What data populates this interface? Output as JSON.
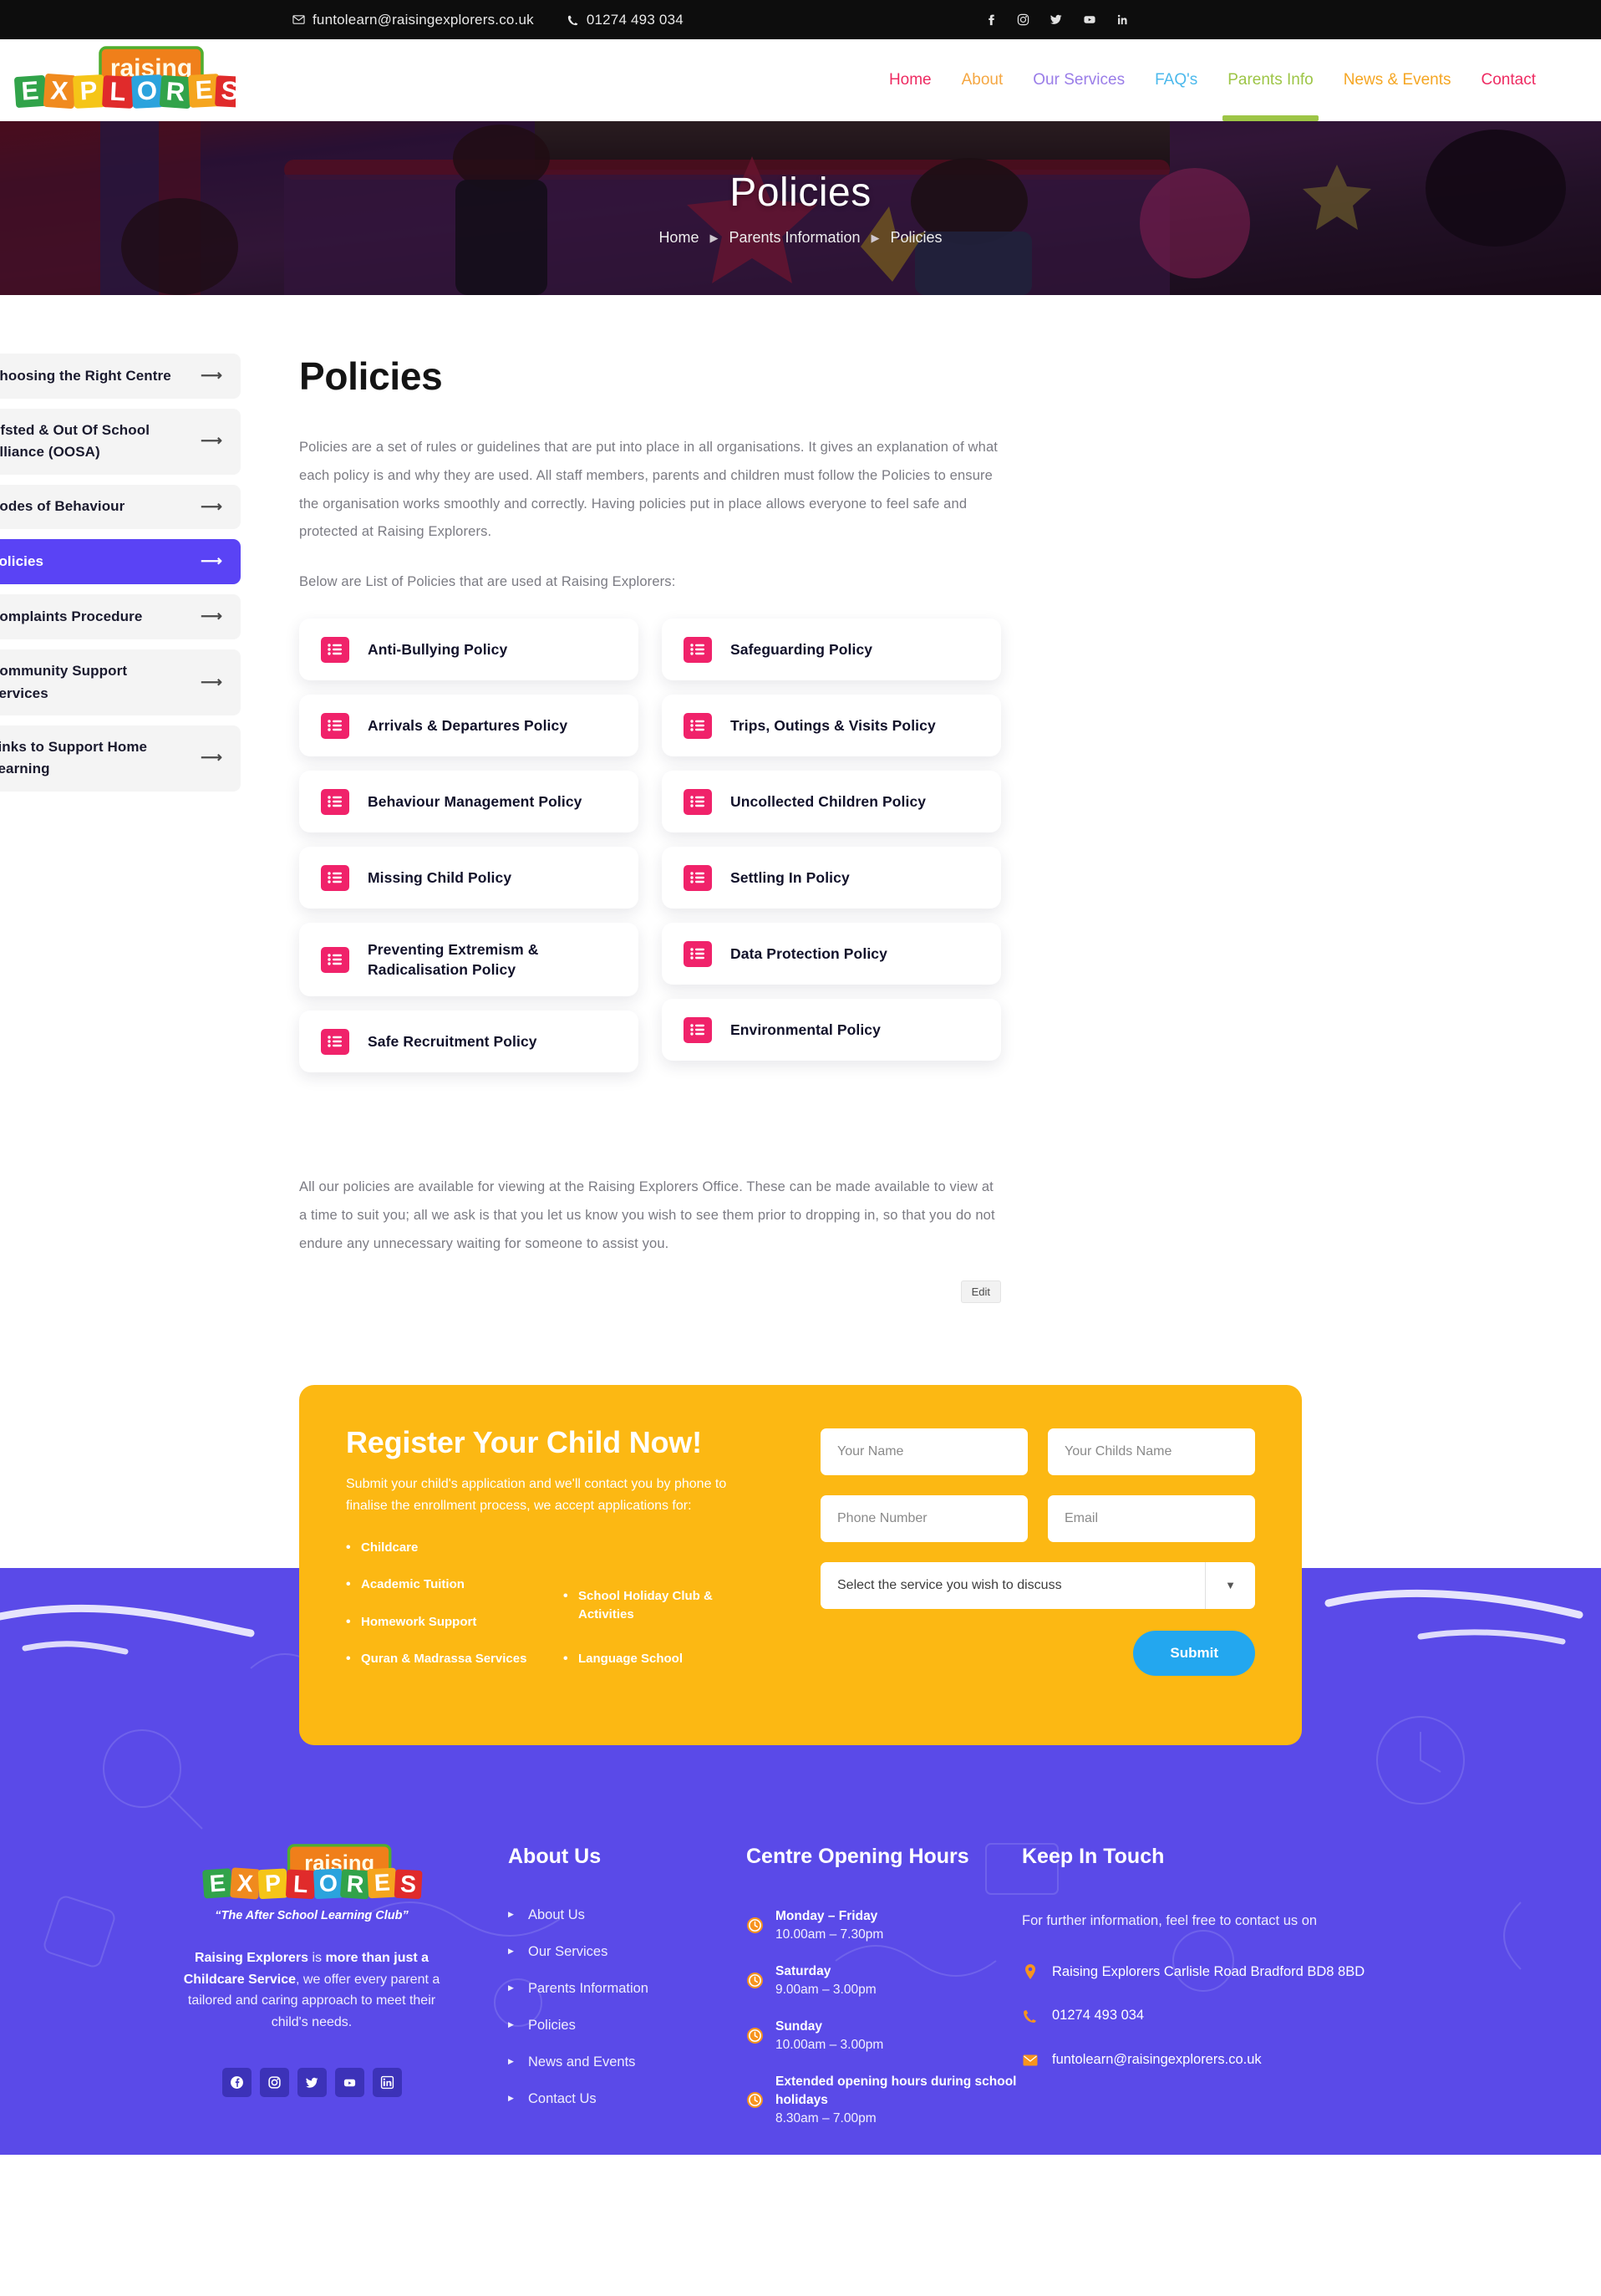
{
  "topbar": {
    "email": "funtolearn@raisingexplorers.co.uk",
    "phone": "01274 493 034",
    "social": [
      "facebook-icon",
      "instagram-icon",
      "twitter-icon",
      "youtube-icon",
      "linkedin-icon"
    ]
  },
  "brand": {
    "logo_top": "raising",
    "logo_bottom": "EXPLORERS",
    "tagline": "“The After School Learning Club”"
  },
  "nav": {
    "items": [
      {
        "label": "Home",
        "color": "#ee2b62",
        "active": false
      },
      {
        "label": "About",
        "color": "#f5a742",
        "active": false
      },
      {
        "label": "Our Services",
        "color": "#9a7de8",
        "active": false
      },
      {
        "label": "FAQ's",
        "color": "#4cb9ec",
        "active": false
      },
      {
        "label": "Parents Info",
        "color": "#9dc546",
        "active": true
      },
      {
        "label": "News & Events",
        "color": "#f5a623",
        "active": false
      },
      {
        "label": "Contact",
        "color": "#ee2b62",
        "active": false
      }
    ]
  },
  "hero": {
    "title": "Policies",
    "breadcrumb": [
      "Home",
      "Parents Information",
      "Policies"
    ]
  },
  "sidebar": {
    "items": [
      {
        "label": "Choosing the Right Centre",
        "active": false
      },
      {
        "label": "Ofsted & Out Of School Alliance (OOSA)",
        "active": false
      },
      {
        "label": "Codes of Behaviour",
        "active": false
      },
      {
        "label": "Policies",
        "active": true
      },
      {
        "label": "Complaints Procedure",
        "active": false
      },
      {
        "label": "Community Support Services",
        "active": false
      },
      {
        "label": "Links to Support Home Learning",
        "active": false
      }
    ]
  },
  "content": {
    "heading": "Policies",
    "intro": "Policies are a set of rules or guidelines that are put into place in all organisations. It gives an explanation of what each policy is and why they are used. All staff members, parents and children must follow the Policies to ensure the organisation works smoothly and correctly. Having policies put in place allows everyone to feel safe and protected at Raising Explorers.",
    "subintro": "Below are List of Policies that are used at Raising Explorers:",
    "closing": "All our policies are available for viewing at the Raising Explorers Office. These can be made available to view at a time to suit you; all we ask is that you let us know you wish to see them prior to dropping in, so that you do not endure any unnecessary waiting for someone to assist you.",
    "edit_label": "Edit",
    "policies_left": [
      "Anti-Bullying Policy",
      "Arrivals & Departures Policy",
      "Behaviour Management Policy",
      "Missing Child Policy",
      "Preventing Extremism & Radicalisation Policy",
      "Safe Recruitment Policy"
    ],
    "policies_right": [
      "Safeguarding Policy",
      "Trips, Outings & Visits Policy",
      "Uncollected Children Policy",
      "Settling In Policy",
      "Data Protection Policy",
      "Environmental Policy"
    ]
  },
  "cta": {
    "title": "Register Your Child Now!",
    "subtitle": "Submit your child's application and we'll contact you by phone to finalise the enrollment process, we accept applications for:",
    "services_col1": [
      "Childcare",
      "Academic Tuition",
      "Homework Support",
      "Quran & Madrassa Services"
    ],
    "services_col2": [
      "School Holiday Club & Activities",
      "Language School"
    ],
    "form": {
      "name_placeholder": "Your Name",
      "child_placeholder": "Your Childs Name",
      "phone_placeholder": "Phone Number",
      "email_placeholder": "Email",
      "select_value": "Select the service you wish to discuss",
      "submit_label": "Submit"
    }
  },
  "footer": {
    "blurb_bold1": "Raising Explorers",
    "blurb_mid1": " is ",
    "blurb_bold2": "more than just a Childcare Service",
    "blurb_rest": ", we offer every parent a tailored and caring approach to meet their child's needs.",
    "about_head": "About Us",
    "about_links": [
      "About Us",
      "Our Services",
      "Parents Information",
      "Policies",
      "News and Events",
      "Contact Us"
    ],
    "hours_head": "Centre Opening Hours",
    "hours": [
      {
        "day": "Monday – Friday",
        "time": "10.00am – 7.30pm"
      },
      {
        "day": "Saturday",
        "time": "9.00am – 3.00pm"
      },
      {
        "day": "Sunday",
        "time": "10.00am – 3.00pm"
      },
      {
        "day": "Extended opening hours during school holidays",
        "time": "8.30am – 7.00pm"
      }
    ],
    "touch_head": "Keep In Touch",
    "touch_intro": "For further information, feel free to contact us on",
    "address": "Raising Explorers Carlisle Road Bradford BD8 8BD",
    "phone": "01274 493 034",
    "email": "funtolearn@raisingexplorers.co.uk"
  },
  "colors": {
    "accent_purple": "#5a43f5",
    "accent_pink": "#f0226a",
    "accent_yellow": "#fcb813",
    "accent_blue": "#23a7ef",
    "footer_purple": "#5a4ae8",
    "nav_active_green": "#9dc546"
  }
}
